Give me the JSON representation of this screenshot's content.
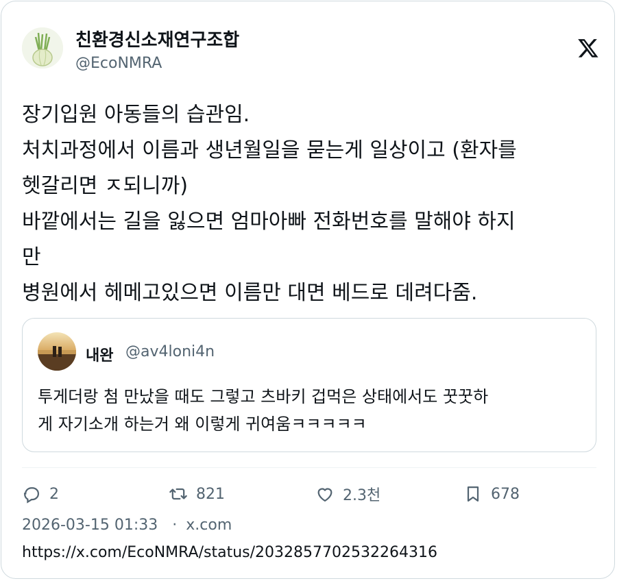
{
  "author": {
    "display_name": "친환경신소재연구조합",
    "handle": "@EcoNMRA",
    "avatar_icon": "fennel-avatar"
  },
  "platform_icon": "x-logo-icon",
  "tweet": {
    "lines": [
      "장기입원 아동들의 습관임.",
      "처치과정에서 이름과 생년월일을 묻는게 일상이고 (환자를",
      "헷갈리면 ㅈ되니까)",
      "바깥에서는 길을 잃으면 엄마아빠 전화번호를 말해야 하지",
      "만",
      "병원에서 헤메고있으면 이름만 대면 베드로 데려다줌."
    ]
  },
  "quote": {
    "display_name": "내완",
    "handle": "@av4loni4n",
    "text_lines": [
      "투게더랑 첨 만났을 때도 그렇고 츠바키 겁먹은 상태에서도 꿋꿋하",
      "게 자기소개 하는거 왜 이렇게 귀여움ㅋㅋㅋㅋㅋ"
    ]
  },
  "actions": {
    "replies": "2",
    "retweets": "821",
    "likes": "2.3천",
    "bookmarks": "678"
  },
  "meta": {
    "timestamp": "2026-03-15 01:33",
    "separator": "·",
    "site": "x.com"
  },
  "url": "https://x.com/EcoNMRA/status/2032857702532264316",
  "colors": {
    "text": "#0f1419",
    "secondary": "#536471",
    "border": "#cfd9de"
  }
}
